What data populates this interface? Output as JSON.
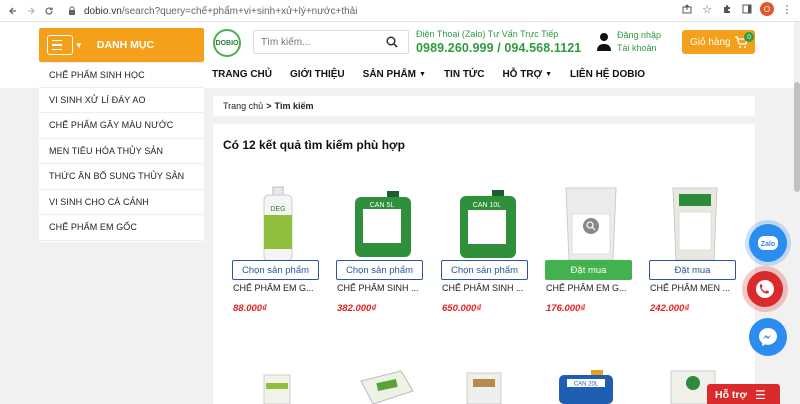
{
  "browser": {
    "url_domain": "dobio.vn",
    "url_path": "/search?query=chế+phẩm+vi+sinh+xử+lý+nước+thải",
    "profile_initial": "O"
  },
  "header": {
    "menu_label": "DANH MỤC",
    "search_placeholder": "Tìm kiếm...",
    "hotline_label": "Điện Thoại (Zalo) Tư Vấn Trực Tiếp",
    "hotline_numbers": "0989.260.999 / 094.568.1121",
    "login": "Đăng nhập",
    "account": "Tài khoản",
    "cart_label": "Giỏ hàng",
    "cart_count": "0"
  },
  "nav": [
    "TRANG CHỦ",
    "GIỚI THIỆU",
    "SẢN PHẨM",
    "TIN TỨC",
    "HỖ TRỢ",
    "LIÊN HỆ DOBIO"
  ],
  "sidebar": [
    "CHẾ PHẨM SINH HỌC",
    "VI SINH XỬ LÍ ĐÁY AO",
    "CHẾ PHẨM GÂY MÀU NƯỚC",
    "MEN TIÊU HÓA THỦY SẢN",
    "THỨC ĂN BỔ SUNG THỦY SẢN",
    "VI SINH CHO CÁ CẢNH",
    "CHẾ PHẨM EM GỐC"
  ],
  "breadcrumb": {
    "home": "Trang chủ",
    "sep": ">",
    "current": "Tìm kiếm"
  },
  "results_title": "Có 12 kết quả tìm kiếm phù hợp",
  "products": [
    {
      "name": "CHẾ PHẨM EM G...",
      "price": "88.000₫",
      "button": "Chọn sản phẩm",
      "img_label": "DEG"
    },
    {
      "name": "CHẾ PHẨM SINH ...",
      "price": "382.000₫",
      "button": "Chọn sản phẩm",
      "img_label": "CAN 5L"
    },
    {
      "name": "CHẾ PHẨM SINH ...",
      "price": "650.000₫",
      "button": "Chọn sản phẩm",
      "img_label": "CAN 10L"
    },
    {
      "name": "CHẾ PHẨM EM G...",
      "price": "176.000₫",
      "button": "Đặt mua"
    },
    {
      "name": "CHẾ PHẨM MEN ...",
      "price": "242.000₫",
      "button": "Đặt mua"
    }
  ],
  "row2_labels": [
    "CAN 20L"
  ],
  "support_label": "Hỗ trợ",
  "zalo_label": "Zalo"
}
